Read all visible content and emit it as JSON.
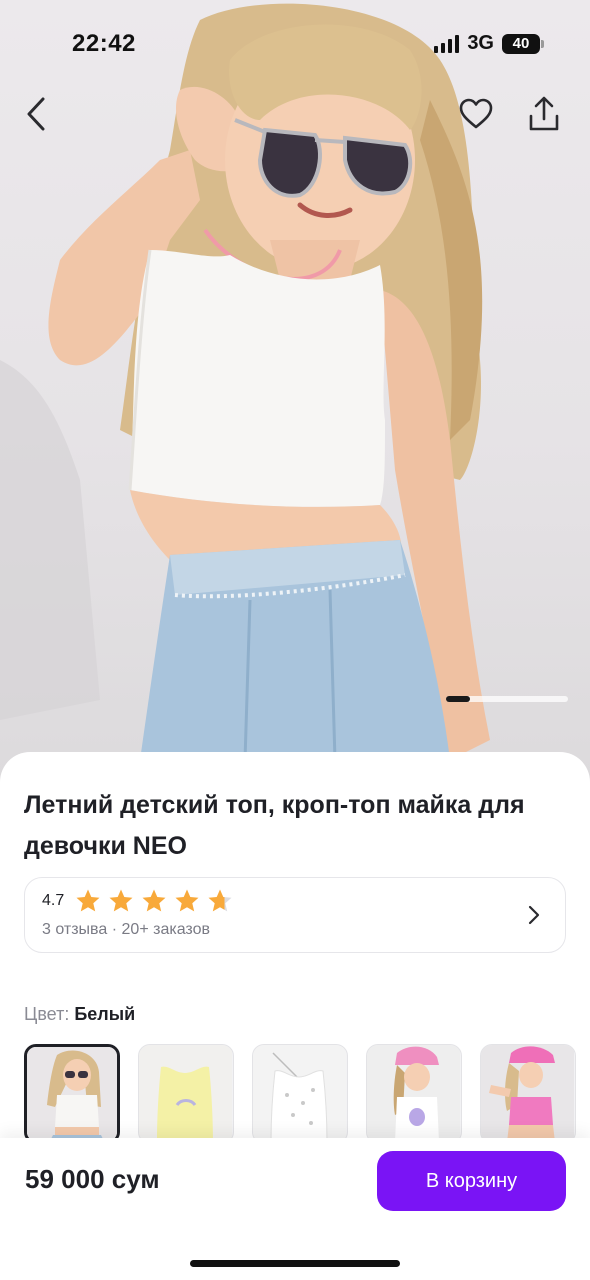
{
  "status_bar": {
    "time": "22:42",
    "network": "3G",
    "battery": "40"
  },
  "nav": {
    "back_icon": "chevron-left-icon",
    "favorite_icon": "heart-icon",
    "share_icon": "share-icon"
  },
  "carousel": {
    "current_index": 1
  },
  "product": {
    "title": "Летний детский топ, кроп-топ майка для девочки NEO",
    "rating": {
      "value": "4.7",
      "stars": 4.7,
      "reviews": "3 отзыва",
      "separator": "·",
      "orders": "20+ заказов"
    },
    "color": {
      "label": "Цвет:",
      "value": "Белый"
    }
  },
  "bottom_bar": {
    "price": "59 000 сум",
    "cart_button": "В корзину"
  },
  "colors": {
    "accent": "#7a14f5",
    "star": "#f8a93a",
    "text_primary": "#1f2026",
    "text_secondary": "#7a7b85"
  }
}
